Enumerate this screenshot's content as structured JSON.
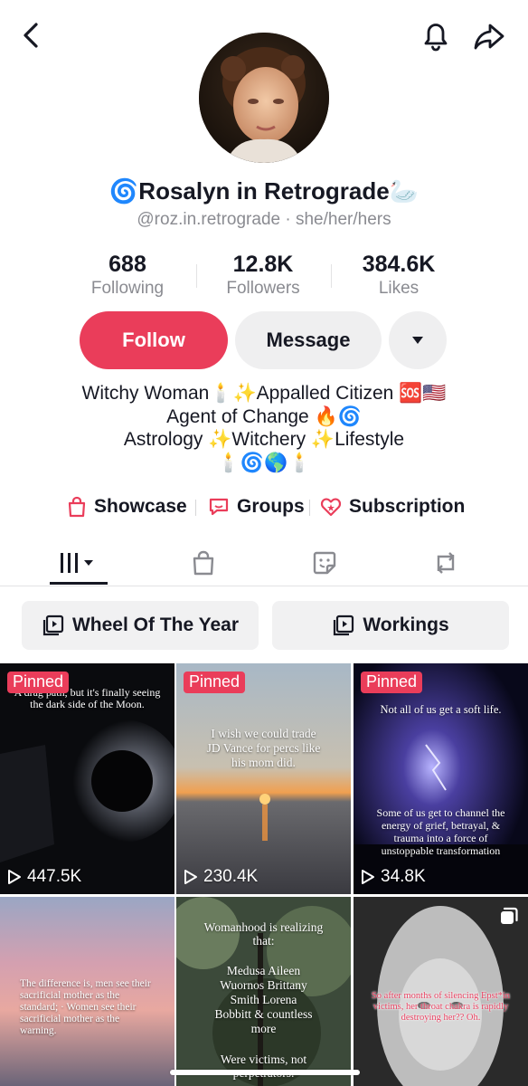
{
  "header": {
    "back_icon": "chevron-left-icon",
    "bell_icon": "bell-icon",
    "share_icon": "share-arrow-icon"
  },
  "profile": {
    "name_prefix_emoji": "🌀",
    "name": "Rosalyn in Retrograde",
    "name_suffix_emoji": "🦢",
    "handle": "@roz.in.retrograde",
    "separator": " · ",
    "pronouns": "she/her/hers"
  },
  "stats": [
    {
      "value": "688",
      "label": "Following"
    },
    {
      "value": "12.8K",
      "label": "Followers"
    },
    {
      "value": "384.6K",
      "label": "Likes"
    }
  ],
  "actions": {
    "follow": "Follow",
    "message": "Message",
    "more_icon": "caret-down-icon"
  },
  "bio": [
    "Witchy Woman🕯️✨Appalled Citizen 🆘🇺🇸",
    "Agent of Change 🔥🌀",
    "Astrology ✨Witchery ✨Lifestyle",
    "🕯️🌀🌎🕯️"
  ],
  "links": [
    {
      "label": "Showcase",
      "icon": "shopping-bag-icon"
    },
    {
      "label": "Groups",
      "icon": "chat-bubble-icon"
    },
    {
      "label": "Subscription",
      "icon": "heart-star-icon"
    }
  ],
  "tabs": [
    {
      "icon": "grid-bars-icon",
      "active": true
    },
    {
      "icon": "bag-icon",
      "active": false
    },
    {
      "icon": "sticker-icon",
      "active": false
    },
    {
      "icon": "repost-icon",
      "active": false
    }
  ],
  "playlists": [
    {
      "label": "Wheel Of The Year",
      "icon": "playlist-icon"
    },
    {
      "label": "Workings",
      "icon": "playlist-icon"
    }
  ],
  "videos": [
    {
      "pinned": "Pinned",
      "views": "447.5K",
      "caption": "A drag path, but it's finally seeing the dark side of the Moon."
    },
    {
      "pinned": "Pinned",
      "views": "230.4K",
      "caption": "I wish we could trade JD Vance for percs like his mom did."
    },
    {
      "pinned": "Pinned",
      "views": "34.8K",
      "caption_top": "Not all of us get a soft life.",
      "caption": "Some of us get to channel the energy of grief, betrayal, & trauma into a force of unstoppable transformation"
    },
    {
      "caption": "The difference is, men see their sacrificial mother as the standard; · Women see their sacrificial mother as the warning."
    },
    {
      "caption_top": "Womanhood is realizing that:",
      "caption": "Medusa Aileen Wuornos Brittany Smith Lorena Bobbitt & countless more",
      "caption_bottom": "Were victims, not perpetrators."
    },
    {
      "caption": "So after months of silencing Epst*in victims, her throat chakra is rapidly destroying her?? Oh.",
      "badge_icon": "multi-photo-icon"
    }
  ],
  "colors": {
    "accent": "#ea3d5a",
    "text": "#161823",
    "muted": "#8a8b91",
    "button_gray": "#efeff0"
  }
}
